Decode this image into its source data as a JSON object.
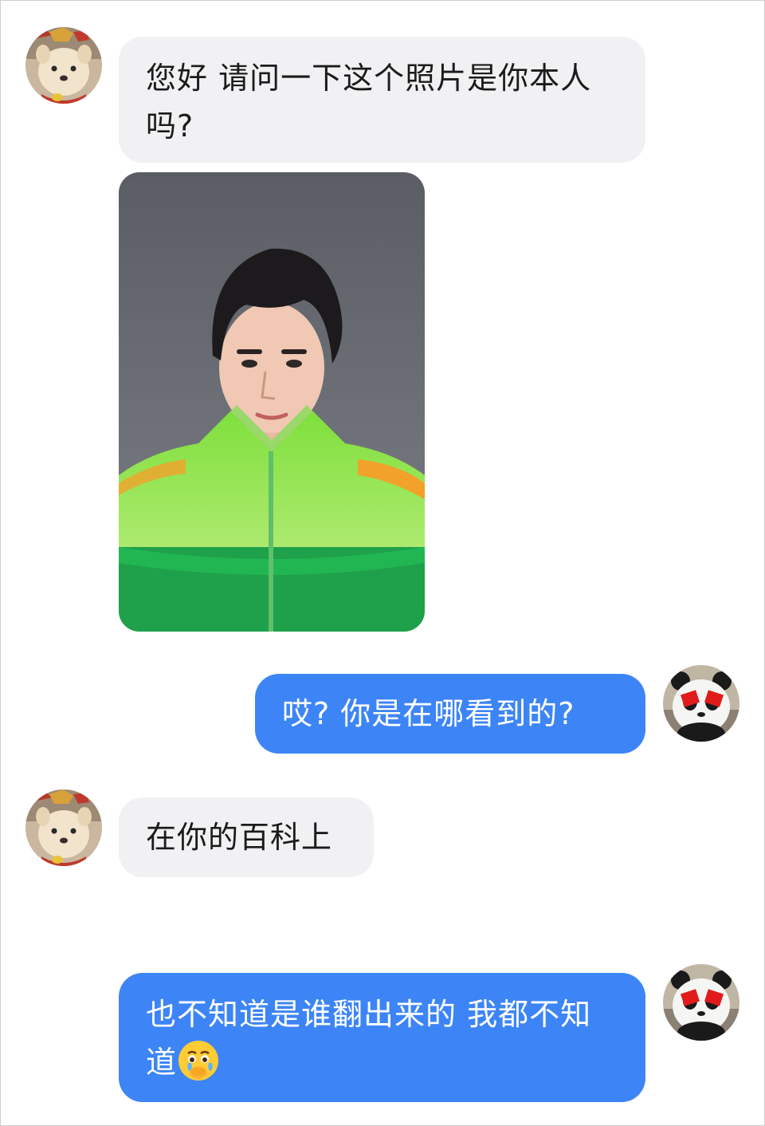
{
  "conversation": {
    "messages": [
      {
        "sender": "other",
        "text": "您好 请问一下这个照片是你本人吗?"
      },
      {
        "sender": "other",
        "type": "image",
        "image_name": "portrait-photo"
      },
      {
        "sender": "self",
        "text": "哎? 你是在哪看到的?"
      },
      {
        "sender": "other",
        "text": "在你的百科上"
      },
      {
        "sender": "self",
        "text": "也不知道是谁翻出来的 我都不知道",
        "emoji": "crying-face-emoji"
      }
    ]
  },
  "avatars": {
    "other": "dog-avatar-icon",
    "self": "panda-avatar-icon"
  },
  "colors": {
    "incoming_bubble": "#f1f1f3",
    "outgoing_bubble": "#3d85f6",
    "incoming_text": "#1b1b1b",
    "outgoing_text": "#ffffff"
  }
}
